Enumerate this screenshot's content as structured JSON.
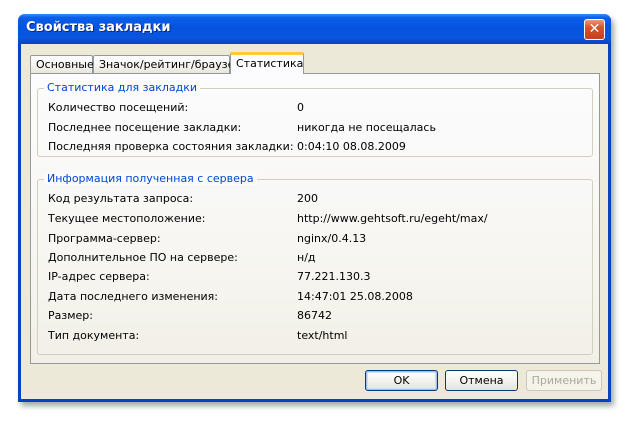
{
  "window": {
    "title": "Свойства закладки",
    "close_glyph": "✕"
  },
  "tabs": [
    {
      "label": "Основные",
      "active": false
    },
    {
      "label": "Значок/рейтинг/браузер",
      "active": false
    },
    {
      "label": "Статистика",
      "active": true
    }
  ],
  "bookmark_stats": {
    "title": "Статистика для закладки",
    "rows": [
      {
        "label": "Количество посещений:",
        "value": "0"
      },
      {
        "label": "Последнее посещение закладки:",
        "value": "никогда не посещалась"
      },
      {
        "label": "Последняя проверка состояния закладки:",
        "value": "0:04:10 08.08.2009"
      }
    ]
  },
  "server_info": {
    "title": "Информация полученная с сервера",
    "rows": [
      {
        "label": "Код результата запроса:",
        "value": "200"
      },
      {
        "label": "Текущее местоположение:",
        "value": "http://www.gehtsoft.ru/egeht/max/"
      },
      {
        "label": "Программа-сервер:",
        "value": "nginx/0.4.13"
      },
      {
        "label": "Дополнительное ПО на сервере:",
        "value": "н/д"
      },
      {
        "label": "IP-адрес сервера:",
        "value": "77.221.130.3"
      },
      {
        "label": "Дата последнего изменения:",
        "value": "14:47:01 25.08.2008"
      },
      {
        "label": "Размер:",
        "value": "86742"
      },
      {
        "label": "Тип документа:",
        "value": "text/html"
      }
    ]
  },
  "buttons": {
    "ok": "OK",
    "cancel": "Отмена",
    "apply": "Применить"
  },
  "colors": {
    "titlebar": "#0553e0",
    "group_title": "#0046d5",
    "active_tab_accent": "#ffc83c"
  }
}
